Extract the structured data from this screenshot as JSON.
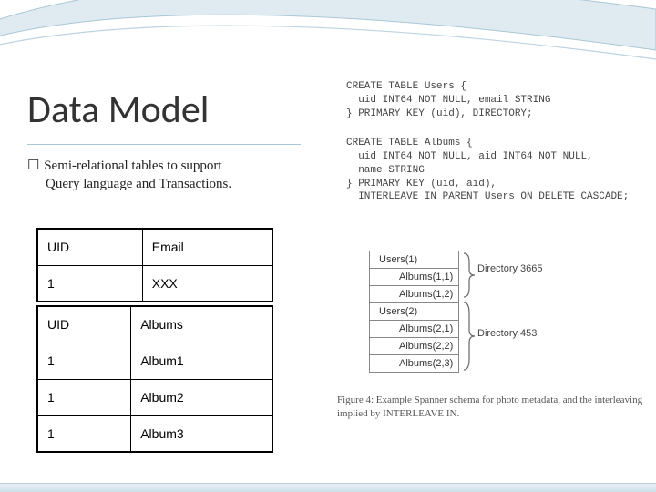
{
  "title": "Data Model",
  "bullet": {
    "line1": "Semi-relational tables to support",
    "line2": "Query language and Transactions."
  },
  "table1": {
    "headers": [
      "UID",
      "Email"
    ],
    "rows": [
      [
        "1",
        "XXX"
      ]
    ]
  },
  "table2": {
    "headers": [
      "UID",
      "Albums"
    ],
    "rows": [
      [
        "1",
        "Album1"
      ],
      [
        "1",
        "Album2"
      ],
      [
        "1",
        "Album3"
      ]
    ]
  },
  "code1": "CREATE TABLE Users {\n  uid INT64 NOT NULL, email STRING\n} PRIMARY KEY (uid), DIRECTORY;",
  "code2": "CREATE TABLE Albums {\n  uid INT64 NOT NULL, aid INT64 NOT NULL,\n  name STRING\n} PRIMARY KEY (uid, aid),\n  INTERLEAVE IN PARENT Users ON DELETE CASCADE;",
  "struct": {
    "rows": [
      {
        "text": "Users(1)",
        "indent": false
      },
      {
        "text": "Albums(1,1)",
        "indent": true
      },
      {
        "text": "Albums(1,2)",
        "indent": true
      },
      {
        "text": "Users(2)",
        "indent": false
      },
      {
        "text": "Albums(2,1)",
        "indent": true
      },
      {
        "text": "Albums(2,2)",
        "indent": true
      },
      {
        "text": "Albums(2,3)",
        "indent": true
      }
    ]
  },
  "dir_labels": {
    "d1": "Directory 3665",
    "d2": "Directory 453"
  },
  "caption": "Figure 4: Example Spanner schema for photo metadata, and the interleaving implied by INTERLEAVE IN."
}
